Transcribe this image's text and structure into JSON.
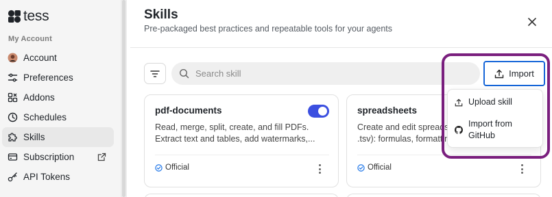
{
  "app": {
    "name": "tess"
  },
  "sidebar": {
    "section_label": "My Account",
    "items": [
      {
        "label": "Account",
        "icon": "avatar-icon"
      },
      {
        "label": "Preferences",
        "icon": "sliders-icon"
      },
      {
        "label": "Addons",
        "icon": "addons-icon"
      },
      {
        "label": "Schedules",
        "icon": "clock-icon"
      },
      {
        "label": "Skills",
        "icon": "puzzle-icon",
        "active": true
      },
      {
        "label": "Subscription",
        "icon": "card-icon",
        "external": true
      },
      {
        "label": "API Tokens",
        "icon": "key-icon"
      }
    ]
  },
  "modal": {
    "title": "Skills",
    "subtitle": "Pre-packaged best practices and repeatable tools for your agents",
    "search_placeholder": "Search skill",
    "import_label": "Import",
    "import_menu": {
      "upload_label": "Upload skill",
      "github_label": "Import from GitHub"
    },
    "cards": [
      {
        "title": "pdf-documents",
        "description": "Read, merge, split, create, and fill PDFs. Extract text and tables, add watermarks,...",
        "badge": "Official",
        "enabled": true
      },
      {
        "title": "spreadsheets",
        "description": "Create and edit spreadsheets (.xlsx, .csv, .tsv): formulas, formatting, charts...",
        "badge": "Official"
      }
    ]
  },
  "colors": {
    "accent": "#3b4fe0",
    "import_border": "#1565d8",
    "highlight": "#7a1f7e",
    "official": "#1a73e8"
  }
}
